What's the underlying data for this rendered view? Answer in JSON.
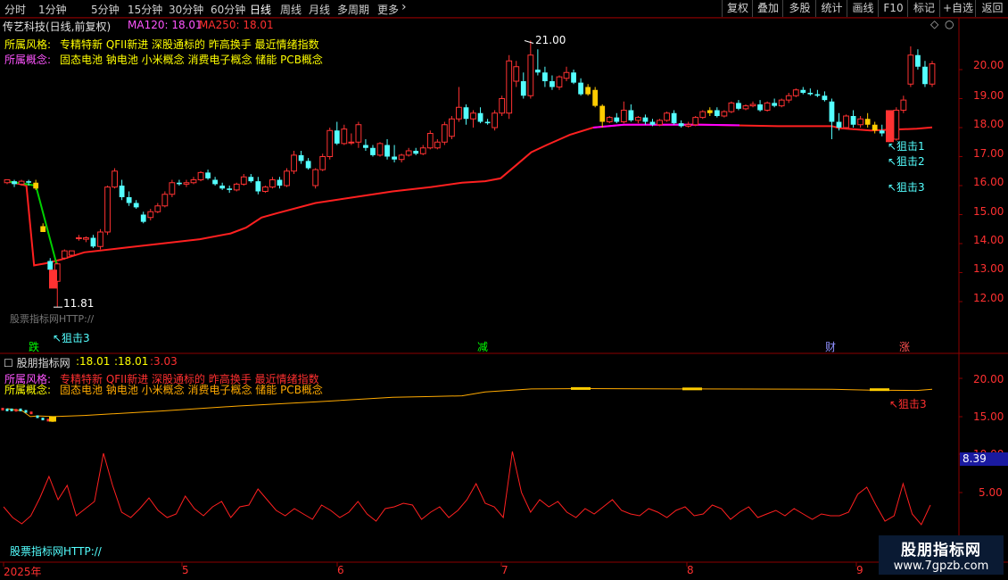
{
  "toolbar": {
    "periods": [
      "分时",
      "1分钟",
      "5分钟",
      "15分钟",
      "30分钟",
      "60分钟",
      "日线",
      "周线",
      "月线",
      "多周期",
      "更多"
    ],
    "active_index": 6,
    "more_icon": "chevron-right-icon",
    "right_buttons": [
      "复权",
      "叠加",
      "多股",
      "统计",
      "画线",
      "F10",
      "标记",
      "+自选",
      "返回"
    ]
  },
  "main_panel": {
    "stock_title": "传艺科技(日线,前复权)",
    "ma120_label": "MA120: 18.01",
    "ma250_label": "MA250: 18.01",
    "style_label": "所属风格:",
    "style_value": "专精特新 QFII新进 深股通标的 昨高换手 最近情绪指数",
    "concept_label": "所属概念:",
    "concept_value": "固态电池 钠电池 小米概念 消费电子概念 储能 PCB概念",
    "high_marker": "21.00",
    "low_marker": "11.81",
    "watermark_text": "股票指标网HTTP://",
    "signals": [
      "↖狙击1",
      "↖狙击2",
      "↖狙击3"
    ],
    "left_signal": "↖狙击3",
    "bottom_tags": [
      "跌",
      "减",
      "财",
      "涨"
    ],
    "y_ticks": [
      "20.00",
      "19.00",
      "18.00",
      "17.00",
      "16.00",
      "15.00",
      "14.00",
      "13.00",
      "12.00"
    ],
    "colors": {
      "up": "#ff3232",
      "down": "#54ffff",
      "ma": "#ff2020",
      "highlight": "#ffcc00",
      "magenta": "#ff00ff",
      "green": "#00d000"
    }
  },
  "sub_panel": {
    "title": "股朋指标网",
    "values": [
      ":18.01",
      ":18.01",
      ":3.03"
    ],
    "style_label": "所属风格:",
    "style_value": "专精特新 QFII新进 深股通标的 昨高换手 最近情绪指数",
    "concept_label": "所属概念:",
    "concept_value": "固态电池 钠电池 小米概念 消费电子概念 储能 PCB概念",
    "signal_overlay": "↖狙击3",
    "value_badge": "8.39",
    "y_ticks": [
      "20.00",
      "15.00",
      "10.00",
      "5.00"
    ],
    "watermark_text": "股票指标网HTTP://"
  },
  "x_axis": {
    "labels": [
      "2025年",
      "5",
      "6",
      "7",
      "8",
      "9"
    ]
  },
  "corner_watermark": {
    "line1": "股朋指标网",
    "line2": "www.7gpzb.com"
  },
  "chart_data": {
    "type": "candlestick",
    "ylim": [
      11.3,
      21.3
    ],
    "y_ticks": [
      20,
      19,
      18,
      17,
      16,
      15,
      14,
      13,
      12
    ],
    "x_month_labels": [
      "2025年",
      "5",
      "6",
      "7",
      "8",
      "9"
    ],
    "candles": [
      [
        16.1,
        16.2,
        16.05,
        16.2
      ],
      [
        16.15,
        16.2,
        15.95,
        16.05
      ],
      [
        16.05,
        16.2,
        16.0,
        16.15
      ],
      [
        16.15,
        16.2,
        16.0,
        16.1
      ],
      [
        16.1,
        16.2,
        15.85,
        15.9
      ],
      [
        14.6,
        14.7,
        14.4,
        14.4
      ],
      [
        13.4,
        13.5,
        13.05,
        13.1
      ],
      [
        12.7,
        13.35,
        11.81,
        13.3
      ],
      [
        13.5,
        13.8,
        13.45,
        13.75
      ],
      [
        13.6,
        13.75,
        13.55,
        13.75
      ],
      [
        14.2,
        14.3,
        14.1,
        14.2
      ],
      [
        14.15,
        14.25,
        14.05,
        14.2
      ],
      [
        14.2,
        14.3,
        13.85,
        13.9
      ],
      [
        13.9,
        14.5,
        13.8,
        14.4
      ],
      [
        14.4,
        16.0,
        14.3,
        15.95
      ],
      [
        15.95,
        16.6,
        15.9,
        16.5
      ],
      [
        16.0,
        16.2,
        15.5,
        15.6
      ],
      [
        15.6,
        15.8,
        15.3,
        15.4
      ],
      [
        15.4,
        15.5,
        15.2,
        15.25
      ],
      [
        15.0,
        15.1,
        14.7,
        14.75
      ],
      [
        14.9,
        15.2,
        14.8,
        15.1
      ],
      [
        15.1,
        15.4,
        15.05,
        15.3
      ],
      [
        15.3,
        15.8,
        15.25,
        15.7
      ],
      [
        15.7,
        16.2,
        15.6,
        16.1
      ],
      [
        16.1,
        16.2,
        16.0,
        16.05
      ],
      [
        16.05,
        16.2,
        15.95,
        16.1
      ],
      [
        16.1,
        16.3,
        16.05,
        16.2
      ],
      [
        16.2,
        16.5,
        16.15,
        16.45
      ],
      [
        16.45,
        16.55,
        16.2,
        16.25
      ],
      [
        16.2,
        16.3,
        16.0,
        16.05
      ],
      [
        16.0,
        16.1,
        15.85,
        15.9
      ],
      [
        15.9,
        16.0,
        15.75,
        15.85
      ],
      [
        15.85,
        16.1,
        15.8,
        16.05
      ],
      [
        16.05,
        16.4,
        16.0,
        16.3
      ],
      [
        16.3,
        16.4,
        16.1,
        16.15
      ],
      [
        16.15,
        16.3,
        15.7,
        15.8
      ],
      [
        15.8,
        16.0,
        15.75,
        15.95
      ],
      [
        15.95,
        16.3,
        15.9,
        16.2
      ],
      [
        16.2,
        16.3,
        15.9,
        16.0
      ],
      [
        16.0,
        16.6,
        15.95,
        16.5
      ],
      [
        16.5,
        17.2,
        16.4,
        17.05
      ],
      [
        17.05,
        17.2,
        16.75,
        16.85
      ],
      [
        16.85,
        16.95,
        16.55,
        16.6
      ],
      [
        16.0,
        16.6,
        15.9,
        16.55
      ],
      [
        16.55,
        17.1,
        16.5,
        17.0
      ],
      [
        17.0,
        18.0,
        16.9,
        17.9
      ],
      [
        17.9,
        18.2,
        17.4,
        17.45
      ],
      [
        17.45,
        18.1,
        17.4,
        17.95
      ],
      [
        17.5,
        17.8,
        17.4,
        17.5
      ],
      [
        17.5,
        18.2,
        17.3,
        18.1
      ],
      [
        17.4,
        17.6,
        17.2,
        17.3
      ],
      [
        17.3,
        17.4,
        17.0,
        17.05
      ],
      [
        17.05,
        17.5,
        17.0,
        17.45
      ],
      [
        17.4,
        17.6,
        16.9,
        17.0
      ],
      [
        17.0,
        17.4,
        16.8,
        16.9
      ],
      [
        16.9,
        17.1,
        16.8,
        17.05
      ],
      [
        17.05,
        17.3,
        17.0,
        17.2
      ],
      [
        17.2,
        17.3,
        17.05,
        17.1
      ],
      [
        17.1,
        17.4,
        17.05,
        17.3
      ],
      [
        17.3,
        17.9,
        17.25,
        17.8
      ],
      [
        17.3,
        17.6,
        17.25,
        17.5
      ],
      [
        17.5,
        18.2,
        17.4,
        18.1
      ],
      [
        17.7,
        18.4,
        17.6,
        18.3
      ],
      [
        18.3,
        19.4,
        18.2,
        18.7
      ],
      [
        18.7,
        18.8,
        18.1,
        18.3
      ],
      [
        18.3,
        18.6,
        18.0,
        18.5
      ],
      [
        18.5,
        18.7,
        18.15,
        18.2
      ],
      [
        18.2,
        18.3,
        18.1,
        18.15
      ],
      [
        18.0,
        18.6,
        17.9,
        18.5
      ],
      [
        18.5,
        19.1,
        18.4,
        19.0
      ],
      [
        18.5,
        20.5,
        18.3,
        20.3
      ],
      [
        19.6,
        20.3,
        19.4,
        20.1
      ],
      [
        19.6,
        19.9,
        19.0,
        19.1
      ],
      [
        19.1,
        21.0,
        19.0,
        20.5
      ],
      [
        20.0,
        20.7,
        19.8,
        19.9
      ],
      [
        19.9,
        20.1,
        19.4,
        19.6
      ],
      [
        19.6,
        19.8,
        19.3,
        19.4
      ],
      [
        19.4,
        19.8,
        19.3,
        19.75
      ],
      [
        19.7,
        20.1,
        19.6,
        19.9
      ],
      [
        19.9,
        20.0,
        19.5,
        19.55
      ],
      [
        19.55,
        19.7,
        19.1,
        19.15
      ],
      [
        19.15,
        19.5,
        19.1,
        19.4
      ],
      [
        19.3,
        19.4,
        18.7,
        18.75
      ],
      [
        18.75,
        18.8,
        18.0,
        18.2
      ],
      [
        18.2,
        18.4,
        18.15,
        18.35
      ],
      [
        18.35,
        18.5,
        18.15,
        18.2
      ],
      [
        18.2,
        18.9,
        18.15,
        18.6
      ],
      [
        18.6,
        18.8,
        18.2,
        18.25
      ],
      [
        18.25,
        18.4,
        18.15,
        18.35
      ],
      [
        18.35,
        18.45,
        18.1,
        18.2
      ],
      [
        18.2,
        18.3,
        18.05,
        18.1
      ],
      [
        18.1,
        18.3,
        18.05,
        18.25
      ],
      [
        18.25,
        18.55,
        18.2,
        18.5
      ],
      [
        18.5,
        18.6,
        18.1,
        18.15
      ],
      [
        18.15,
        18.25,
        18.0,
        18.05
      ],
      [
        18.05,
        18.2,
        18.0,
        18.1
      ],
      [
        18.1,
        18.4,
        18.05,
        18.35
      ],
      [
        18.35,
        18.6,
        18.3,
        18.55
      ],
      [
        18.5,
        18.7,
        18.4,
        18.6
      ],
      [
        18.6,
        18.7,
        18.35,
        18.4
      ],
      [
        18.4,
        18.6,
        18.35,
        18.55
      ],
      [
        18.55,
        18.9,
        18.5,
        18.85
      ],
      [
        18.85,
        18.95,
        18.6,
        18.65
      ],
      [
        18.65,
        18.8,
        18.6,
        18.75
      ],
      [
        18.75,
        18.9,
        18.7,
        18.8
      ],
      [
        18.8,
        18.95,
        18.55,
        18.6
      ],
      [
        18.6,
        18.9,
        18.55,
        18.85
      ],
      [
        18.85,
        19.0,
        18.7,
        18.75
      ],
      [
        18.75,
        19.0,
        18.7,
        18.95
      ],
      [
        18.95,
        19.2,
        18.85,
        19.1
      ],
      [
        19.1,
        19.35,
        19.05,
        19.3
      ],
      [
        19.3,
        19.4,
        19.15,
        19.2
      ],
      [
        19.2,
        19.35,
        19.1,
        19.15
      ],
      [
        19.15,
        19.3,
        19.05,
        19.1
      ],
      [
        19.1,
        19.25,
        18.9,
        18.95
      ],
      [
        18.9,
        19.0,
        17.6,
        18.2
      ],
      [
        18.2,
        18.5,
        17.9,
        18.0
      ],
      [
        18.0,
        18.45,
        17.95,
        18.4
      ],
      [
        18.4,
        18.6,
        18.0,
        18.1
      ],
      [
        18.1,
        18.4,
        18.0,
        18.3
      ],
      [
        18.3,
        18.5,
        18.0,
        18.1
      ],
      [
        18.1,
        18.2,
        17.8,
        17.9
      ],
      [
        17.9,
        18.1,
        17.7,
        17.8
      ],
      [
        17.8,
        17.9,
        17.5,
        17.6
      ],
      [
        17.6,
        18.7,
        17.55,
        18.6
      ],
      [
        18.6,
        19.1,
        18.5,
        18.95
      ],
      [
        19.5,
        20.8,
        19.4,
        20.5
      ],
      [
        20.5,
        20.7,
        20.0,
        20.1
      ],
      [
        20.1,
        20.3,
        19.4,
        19.5
      ],
      [
        19.5,
        20.3,
        19.4,
        20.2
      ]
    ],
    "ma_series_name": "MA120",
    "ma": [
      [
        0,
        16.15
      ],
      [
        5,
        16.0
      ],
      [
        7,
        13.25
      ],
      [
        10,
        13.32
      ],
      [
        14,
        13.45
      ],
      [
        20,
        13.7
      ],
      [
        30,
        13.85
      ],
      [
        40,
        14.0
      ],
      [
        50,
        14.15
      ],
      [
        58,
        14.35
      ],
      [
        62,
        14.55
      ],
      [
        66,
        14.9
      ],
      [
        70,
        15.05
      ],
      [
        80,
        15.4
      ],
      [
        90,
        15.6
      ],
      [
        100,
        15.8
      ],
      [
        110,
        15.95
      ],
      [
        118,
        16.1
      ],
      [
        124,
        16.15
      ],
      [
        128,
        16.25
      ],
      [
        132,
        16.7
      ],
      [
        136,
        17.15
      ],
      [
        140,
        17.4
      ],
      [
        146,
        17.75
      ],
      [
        152,
        18.0
      ],
      [
        160,
        18.1
      ],
      [
        180,
        18.1
      ],
      [
        200,
        18.05
      ],
      [
        214,
        18.05
      ],
      [
        216,
        17.98
      ],
      [
        224,
        17.9
      ],
      [
        232,
        17.94
      ],
      [
        236,
        17.96
      ],
      [
        240,
        18.01
      ]
    ],
    "sub_series_name": "股朋指标网",
    "sub_values": [
      2.8,
      1.6,
      0.9,
      1.8,
      3.8,
      6.2,
      3.6,
      5.2,
      1.8,
      2.6,
      3.4,
      8.8,
      5.2,
      2.2,
      1.6,
      2.6,
      3.8,
      2.4,
      1.6,
      2.0,
      4.0,
      2.6,
      1.8,
      2.8,
      3.4,
      1.6,
      2.8,
      3.0,
      4.8,
      3.6,
      2.4,
      1.8,
      2.6,
      2.0,
      1.4,
      3.0,
      2.4,
      1.6,
      2.2,
      3.4,
      2.0,
      1.2,
      2.6,
      2.8,
      3.2,
      3.0,
      1.4,
      2.2,
      2.8,
      1.6,
      2.4,
      3.6,
      5.4,
      3.2,
      2.8,
      1.6,
      9.0,
      4.4,
      2.2,
      3.6,
      2.8,
      3.4,
      2.2,
      1.6,
      2.6,
      2.0,
      2.8,
      3.6,
      2.4,
      2.0,
      1.8,
      2.6,
      2.2,
      1.6,
      2.4,
      2.8,
      1.8,
      2.0,
      3.0,
      2.6,
      1.4,
      2.2,
      2.8,
      1.6,
      2.0,
      2.4,
      1.8,
      2.6,
      2.0,
      1.4,
      2.0,
      1.8,
      1.8,
      2.2,
      4.2,
      5.0,
      3.0,
      1.2,
      1.8,
      5.4,
      2.0,
      0.8,
      3.0
    ],
    "sub_ylim": [
      0,
      22
    ],
    "sub_upper_line": [
      [
        0,
        16.0
      ],
      [
        4,
        15.7
      ],
      [
        6,
        14.95
      ],
      [
        8,
        15.05
      ],
      [
        12,
        14.95
      ],
      [
        20,
        15.1
      ],
      [
        40,
        15.7
      ],
      [
        60,
        16.35
      ],
      [
        80,
        16.9
      ],
      [
        100,
        17.5
      ],
      [
        110,
        17.6
      ],
      [
        118,
        17.7
      ],
      [
        124,
        18.2
      ],
      [
        136,
        18.6
      ],
      [
        150,
        18.65
      ],
      [
        180,
        18.6
      ],
      [
        214,
        18.55
      ],
      [
        224,
        18.45
      ],
      [
        236,
        18.4
      ],
      [
        240,
        18.55
      ]
    ]
  }
}
